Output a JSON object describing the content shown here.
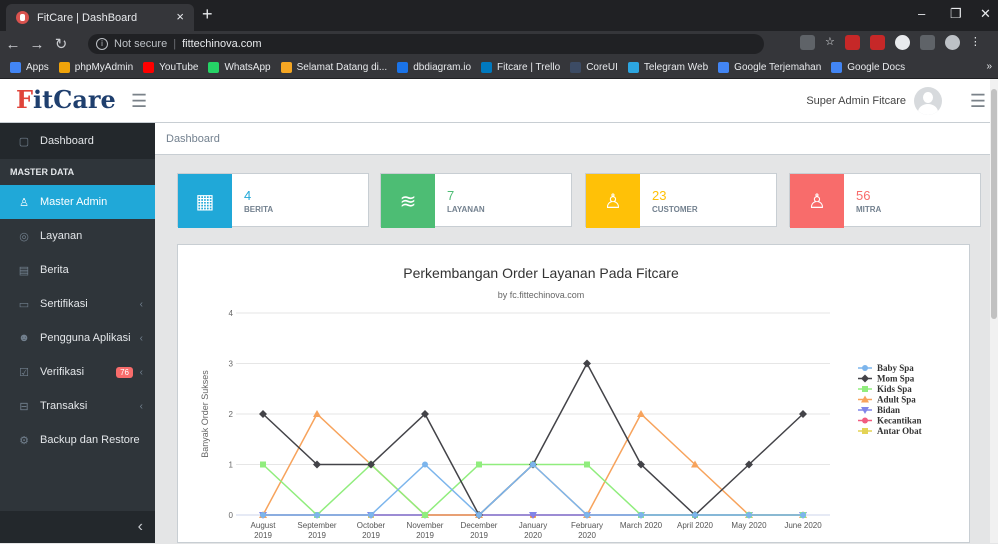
{
  "browser": {
    "tab_title": "FitCare | DashBoard",
    "tab_close": "×",
    "new_tab": "+",
    "not_secure": "Not secure",
    "url": "fittechinova.com",
    "bookmarks_more": "»",
    "bookmarks": [
      {
        "label": "Apps",
        "color": "#4285f4"
      },
      {
        "label": "phpMyAdmin",
        "color": "#f0a30a"
      },
      {
        "label": "YouTube",
        "color": "#ff0000"
      },
      {
        "label": "WhatsApp",
        "color": "#25d366"
      },
      {
        "label": "Selamat Datang di...",
        "color": "#f5a623"
      },
      {
        "label": "dbdiagram.io",
        "color": "#1a73e8"
      },
      {
        "label": "Fitcare | Trello",
        "color": "#0079bf"
      },
      {
        "label": "CoreUI",
        "color": "#3c4b64"
      },
      {
        "label": "Telegram Web",
        "color": "#2ca5e0"
      },
      {
        "label": "Google Terjemahan",
        "color": "#4285f4"
      },
      {
        "label": "Google Docs",
        "color": "#4285f4"
      }
    ]
  },
  "header": {
    "logo_first": "F",
    "logo_rest": "itCare",
    "user_name": "Super Admin Fitcare"
  },
  "sidebar": {
    "dashboard": "Dashboard",
    "section_title": "MASTER DATA",
    "items": [
      {
        "label": "Master Admin",
        "icon": "users-icon",
        "glyph": "♙",
        "active": true,
        "caret": false,
        "badge": ""
      },
      {
        "label": "Layanan",
        "icon": "layers-icon",
        "glyph": "◎",
        "active": false,
        "caret": false,
        "badge": ""
      },
      {
        "label": "Berita",
        "icon": "newspaper-icon",
        "glyph": "▤",
        "active": false,
        "caret": false,
        "badge": ""
      },
      {
        "label": "Sertifikasi",
        "icon": "certificate-icon",
        "glyph": "▭",
        "active": false,
        "caret": true,
        "badge": ""
      },
      {
        "label": "Pengguna Aplikasi",
        "icon": "people-icon",
        "glyph": "☻",
        "active": false,
        "caret": true,
        "badge": ""
      },
      {
        "label": "Verifikasi",
        "icon": "check-square-icon",
        "glyph": "☑",
        "active": false,
        "caret": true,
        "badge": "76"
      },
      {
        "label": "Transaksi",
        "icon": "cart-icon",
        "glyph": "⊟",
        "active": false,
        "caret": true,
        "badge": ""
      },
      {
        "label": "Backup dan Restore",
        "icon": "settings-icon",
        "glyph": "⚙",
        "active": false,
        "caret": false,
        "badge": ""
      }
    ],
    "collapse_glyph": "‹"
  },
  "breadcrumb": "Dashboard",
  "stats": [
    {
      "value": "4",
      "label": "BERITA",
      "color": "#20a8d8",
      "icon": "newspaper-icon",
      "glyph": "▦"
    },
    {
      "value": "7",
      "label": "LAYANAN",
      "color": "#4dbd74",
      "icon": "layers-icon",
      "glyph": "≋"
    },
    {
      "value": "23",
      "label": "CUSTOMER",
      "color": "#ffc107",
      "icon": "user-icon",
      "glyph": "♙"
    },
    {
      "value": "56",
      "label": "MITRA",
      "color": "#f86c6b",
      "icon": "user-icon",
      "glyph": "♙"
    }
  ],
  "chart_data": {
    "type": "line",
    "title": "Perkembangan Order Layanan Pada Fitcare",
    "subtitle": "by fc.fittechinova.com",
    "xlabel": "",
    "ylabel": "Banyak Order Sukses",
    "ylim": [
      0,
      4
    ],
    "yticks": [
      0,
      1,
      2,
      3,
      4
    ],
    "grid": true,
    "legend": "right",
    "categories": [
      "August 2019",
      "September 2019",
      "October 2019",
      "November 2019",
      "December 2019",
      "January 2020",
      "February 2020",
      "March 2020",
      "April 2020",
      "May 2020",
      "June 2020"
    ],
    "series": [
      {
        "name": "Baby Spa",
        "color": "#7cb5ec",
        "marker": "circle",
        "values": [
          0,
          0,
          0,
          1,
          0,
          1,
          0,
          0,
          0,
          0,
          0
        ]
      },
      {
        "name": "Mom Spa",
        "color": "#434348",
        "marker": "diamond",
        "values": [
          2,
          1,
          1,
          2,
          0,
          1,
          3,
          1,
          0,
          1,
          2
        ]
      },
      {
        "name": "Kids Spa",
        "color": "#90ed7d",
        "marker": "square",
        "values": [
          1,
          0,
          1,
          0,
          1,
          1,
          1,
          0,
          0,
          0,
          0
        ]
      },
      {
        "name": "Adult Spa",
        "color": "#f7a35c",
        "marker": "triangle",
        "values": [
          0,
          2,
          1,
          0,
          0,
          1,
          0,
          2,
          1,
          0,
          0
        ]
      },
      {
        "name": "Bidan",
        "color": "#8085e9",
        "marker": "triangle-down",
        "values": [
          0,
          0,
          0,
          0,
          0,
          0,
          0,
          0,
          0,
          0,
          0
        ]
      },
      {
        "name": "Kecantikan",
        "color": "#f15c80",
        "marker": "circle",
        "values": [
          0,
          0,
          0,
          0,
          0,
          0,
          0,
          0,
          0,
          0,
          0
        ]
      },
      {
        "name": "Antar Obat",
        "color": "#e4d354",
        "marker": "square",
        "values": [
          0,
          0,
          0,
          0,
          0,
          0,
          0,
          0,
          0,
          0,
          0
        ]
      }
    ]
  }
}
